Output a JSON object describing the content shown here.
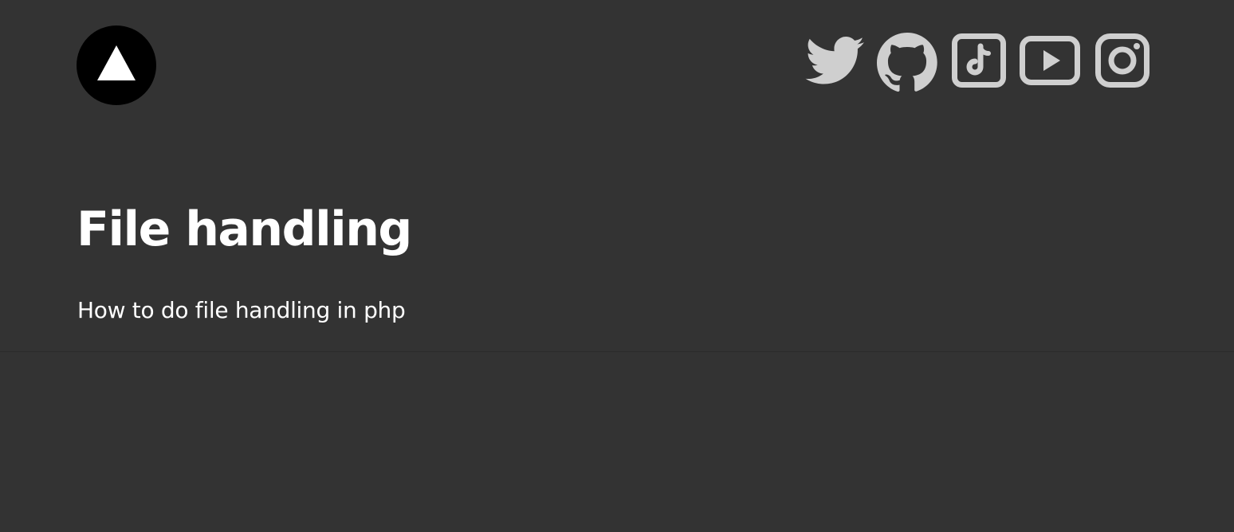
{
  "header": {
    "logo_icon": "triangle-logo-icon",
    "social_links": [
      {
        "name": "twitter",
        "icon": "twitter-icon"
      },
      {
        "name": "github",
        "icon": "github-icon"
      },
      {
        "name": "tiktok",
        "icon": "tiktok-icon"
      },
      {
        "name": "youtube",
        "icon": "youtube-icon"
      },
      {
        "name": "instagram",
        "icon": "instagram-icon"
      }
    ]
  },
  "hero": {
    "title": "File handling",
    "subtitle": "How to do file handling in php"
  },
  "colors": {
    "background": "#333333",
    "logo_background": "#000000",
    "icon": "#cfcfcf",
    "text": "#ffffff",
    "divider": "#2b2b2b"
  }
}
